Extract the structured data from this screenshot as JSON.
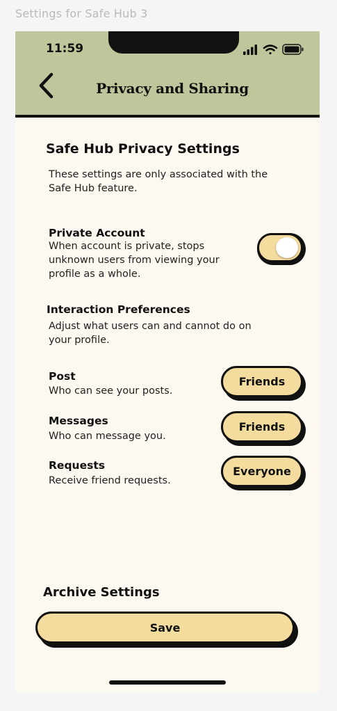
{
  "frame_label": "Settings for Safe Hub 3",
  "status_bar": {
    "time": "11:59"
  },
  "header": {
    "title": "Privacy and Sharing"
  },
  "privacy": {
    "title": "Safe Hub Privacy Settings",
    "description": "These settings are only associated with the Safe Hub feature."
  },
  "private_account": {
    "label": "Private Account",
    "description": "When account is private, stops unknown users from viewing your profile as a whole.",
    "enabled": true
  },
  "interaction": {
    "title": "Interaction Preferences",
    "description": "Adjust what users can and cannot do on your profile."
  },
  "options": [
    {
      "label": "Post",
      "description": "Who can see your posts.",
      "value": "Friends"
    },
    {
      "label": "Messages",
      "description": "Who can message you.",
      "value": "Friends"
    },
    {
      "label": "Requests",
      "description": "Receive friend requests.",
      "value": "Everyone"
    }
  ],
  "archive_settings": "Archive Settings",
  "save_label": "Save",
  "colors": {
    "header_bg": "#bec69b",
    "page_bg": "#fdf8f0",
    "accent": "#f4dc9f",
    "ink": "#111111"
  }
}
